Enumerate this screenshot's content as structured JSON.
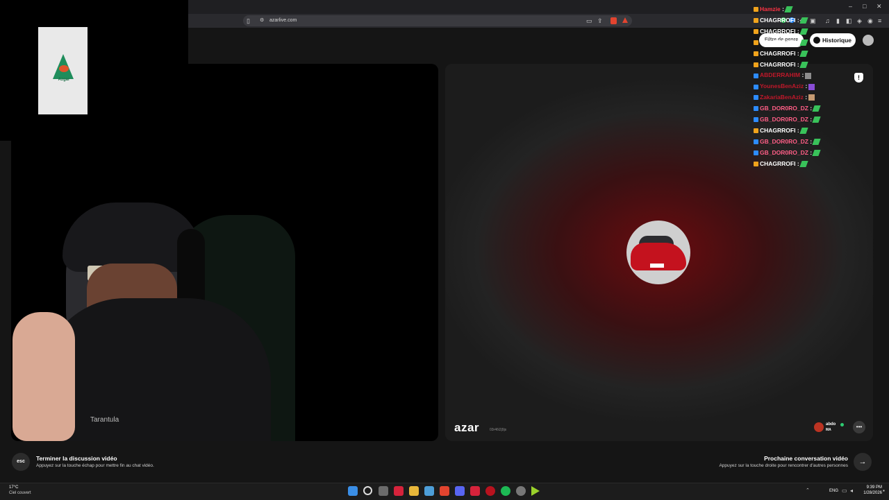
{
  "browser": {
    "url": "azarlive.com",
    "window_controls": [
      "–",
      "□",
      "✕"
    ]
  },
  "azar": {
    "brand": "azar",
    "session_id": "03r46i2j9js",
    "filter_label": "Filtre de genre",
    "history_label": "Historique",
    "peer": {
      "name": "abdo",
      "country": "MA"
    },
    "overlay_logo_text": "Azgar"
  },
  "stream": {
    "shirt_text": "Tarantula"
  },
  "chat": {
    "messages": [
      {
        "user": "Hamzie",
        "sep": ":",
        "color": "#ff3344",
        "emote": "green"
      },
      {
        "user": "CHAGRROFI",
        "sep": ":",
        "color": "#ffffff",
        "emote": "green"
      },
      {
        "user": "CHAGRROFI",
        "sep": ":",
        "color": "#ffffff",
        "emote": "green"
      },
      {
        "user": "CHAGRROFI",
        "sep": ":",
        "color": "#ffffff",
        "emote": "green"
      },
      {
        "user": "CHAGRROFI",
        "sep": ":",
        "color": "#ffffff",
        "emote": "green"
      },
      {
        "user": "CHAGRROFI",
        "sep": ":",
        "color": "#ffffff",
        "emote": "green"
      },
      {
        "user": "ABDERRAHIM",
        "sep": ":",
        "color": "#c0182a",
        "emote": "gray"
      },
      {
        "user": "YounesBenAziz",
        "sep": ":",
        "color": "#c0182a",
        "emote": "purple"
      },
      {
        "user": "ZakariaBenAziz",
        "sep": ":",
        "color": "#c0182a",
        "emote": "tan"
      },
      {
        "user": "GB_DOR0RO_DZ",
        "sep": ":",
        "color": "#ff5e86",
        "emote": "green"
      },
      {
        "user": "GB_DOR0RO_DZ",
        "sep": ":",
        "color": "#ff5e86",
        "emote": "green"
      },
      {
        "user": "CHAGRROFI",
        "sep": ":",
        "color": "#ffffff",
        "emote": "green"
      },
      {
        "user": "GB_DOR0RO_DZ",
        "sep": ":",
        "color": "#ff5e86",
        "emote": "green"
      },
      {
        "user": "GB_DOR0RO_DZ",
        "sep": ":",
        "color": "#ff5e86",
        "emote": "green"
      },
      {
        "user": "CHAGRROFI",
        "sep": ":",
        "color": "#ffffff",
        "emote": "green"
      }
    ]
  },
  "hints": {
    "esc_key": "esc",
    "end_title": "Terminer la discussion vidéo",
    "end_sub": "Appuyez sur la touche échap pour mettre fin au chat vidéo.",
    "next_title": "Prochaine conversation vidéo",
    "next_sub": "Appuyez sur la touche droite pour rencontrer d'autres personnes",
    "next_arrow": "→"
  },
  "taskbar": {
    "weather_temp": "17°C",
    "weather_desc": "Ciel couvert",
    "lang": "ENG",
    "time": "9:39 PM",
    "date": "1/28/2026"
  },
  "colors": {
    "chat_badge_gold": "#f0a31c",
    "chat_badge_blue": "#2d8cff",
    "emote_green": "#39c25a",
    "accent_red": "#c4121e"
  }
}
